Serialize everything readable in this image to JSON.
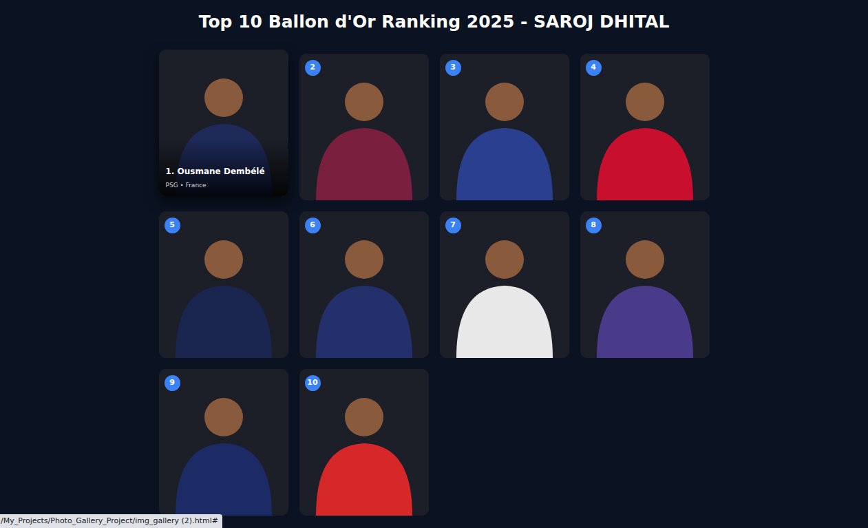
{
  "window": {
    "title": "Top 10 Ballon d'Or Ranking 2025 - SAROJ DHITAL"
  },
  "gallery": [
    {
      "badge": "",
      "hovered": true,
      "caption": {
        "name": "1. Ousmane Dembélé",
        "sub": "PSG • France"
      },
      "color": "#1e2a5a"
    },
    {
      "badge": "2",
      "hovered": false,
      "color": "#7a1f3d"
    },
    {
      "badge": "3",
      "hovered": false,
      "color": "#2a3f8f"
    },
    {
      "badge": "4",
      "hovered": false,
      "color": "#c8102e"
    },
    {
      "badge": "5",
      "hovered": false,
      "color": "#1a2550"
    },
    {
      "badge": "6",
      "hovered": false,
      "color": "#23306b"
    },
    {
      "badge": "7",
      "hovered": false,
      "color": "#e8e8e8"
    },
    {
      "badge": "8",
      "hovered": false,
      "color": "#4a3a8a"
    },
    {
      "badge": "9",
      "hovered": false,
      "color": "#1c2a66"
    },
    {
      "badge": "10",
      "hovered": false,
      "color": "#d62828"
    }
  ],
  "status_bar": "/My_Projects/Photo_Gallery_Project/img_gallery (2).html#"
}
